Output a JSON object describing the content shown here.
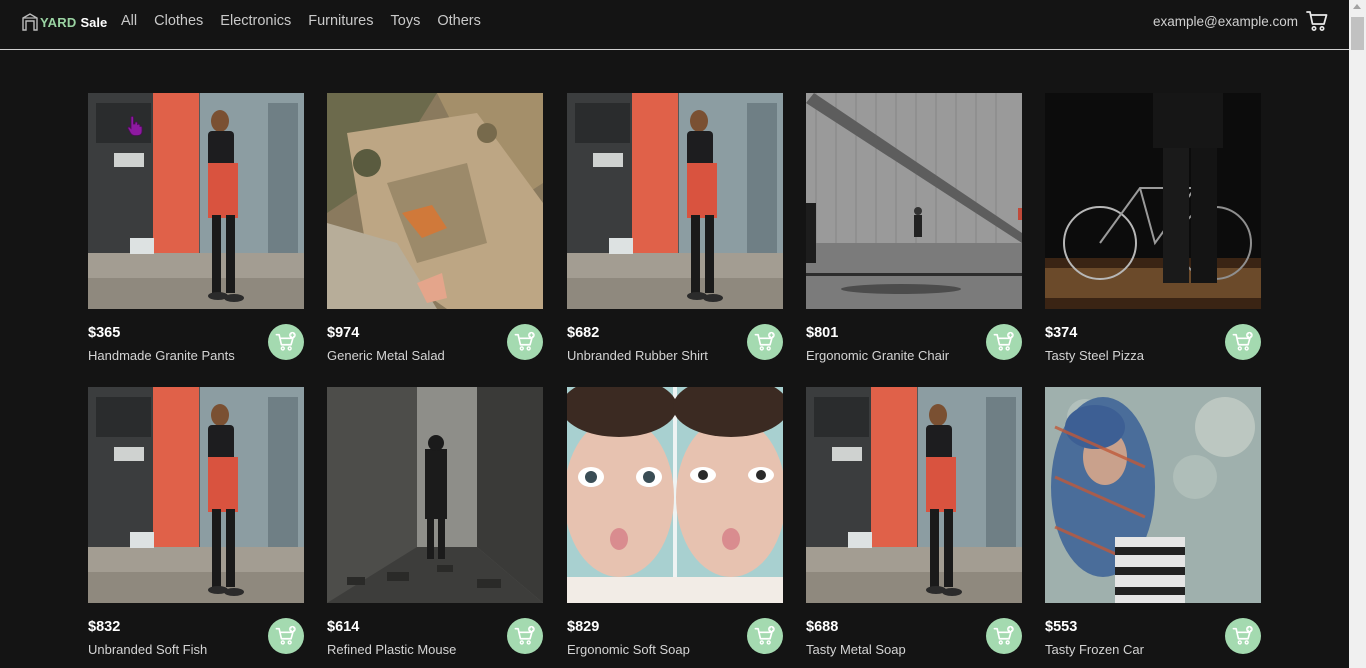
{
  "brand": {
    "yard": "YARD",
    "sale": "Sale"
  },
  "nav": {
    "links": [
      "All",
      "Clothes",
      "Electronics",
      "Furnitures",
      "Toys",
      "Others"
    ]
  },
  "user": {
    "email": "example@example.com"
  },
  "colors": {
    "accent": "#a4dab0",
    "brand_green": "#9ad3a2",
    "background": "#141414"
  },
  "products": [
    {
      "price": "$365",
      "name": "Handmade Granite Pants",
      "image": "woman-phone-street"
    },
    {
      "price": "$974",
      "name": "Generic Metal Salad",
      "image": "rock-closeup"
    },
    {
      "price": "$682",
      "name": "Unbranded Rubber Shirt",
      "image": "woman-phone-street"
    },
    {
      "price": "$801",
      "name": "Ergonomic Granite Chair",
      "image": "man-walking-wall"
    },
    {
      "price": "$374",
      "name": "Tasty Steel Pizza",
      "image": "bicycle-silhouette"
    },
    {
      "price": "$832",
      "name": "Unbranded Soft Fish",
      "image": "woman-phone-street"
    },
    {
      "price": "$614",
      "name": "Refined Plastic Mouse",
      "image": "person-concrete-corridor"
    },
    {
      "price": "$829",
      "name": "Ergonomic Soft Soap",
      "image": "twin-faces"
    },
    {
      "price": "$688",
      "name": "Tasty Metal Soap",
      "image": "woman-phone-street"
    },
    {
      "price": "$553",
      "name": "Tasty Frozen Car",
      "image": "woman-scarf"
    }
  ]
}
